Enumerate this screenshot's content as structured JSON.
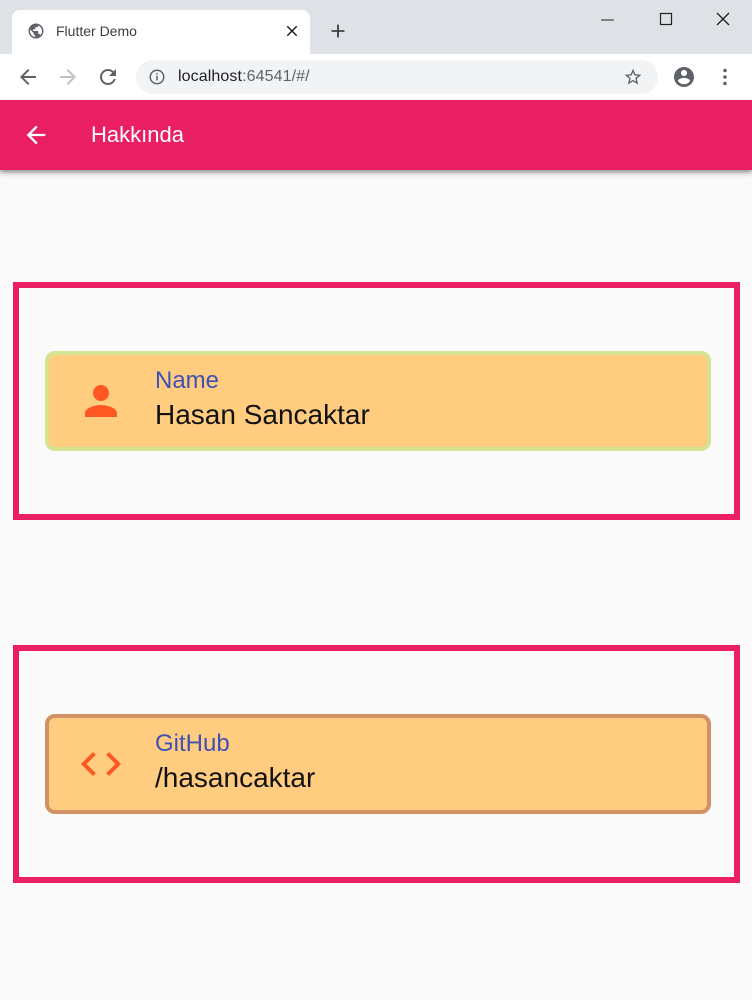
{
  "browser": {
    "tab_title": "Flutter Demo",
    "url_host": "localhost",
    "url_path": ":64541/#/"
  },
  "appbar": {
    "title": "Hakkında"
  },
  "cards": [
    {
      "label": "Name",
      "value": "Hasan Sancaktar",
      "icon": "person-icon"
    },
    {
      "label": "GitHub",
      "value": "/hasancaktar",
      "icon": "code-icon"
    }
  ],
  "colors": {
    "primary": "#e91e63",
    "tile_background": "#ffcc80",
    "label": "#3f51b5",
    "icon": "#ff5722",
    "name_tile_border": "#d4e38f",
    "github_tile_border": "#d19162"
  }
}
